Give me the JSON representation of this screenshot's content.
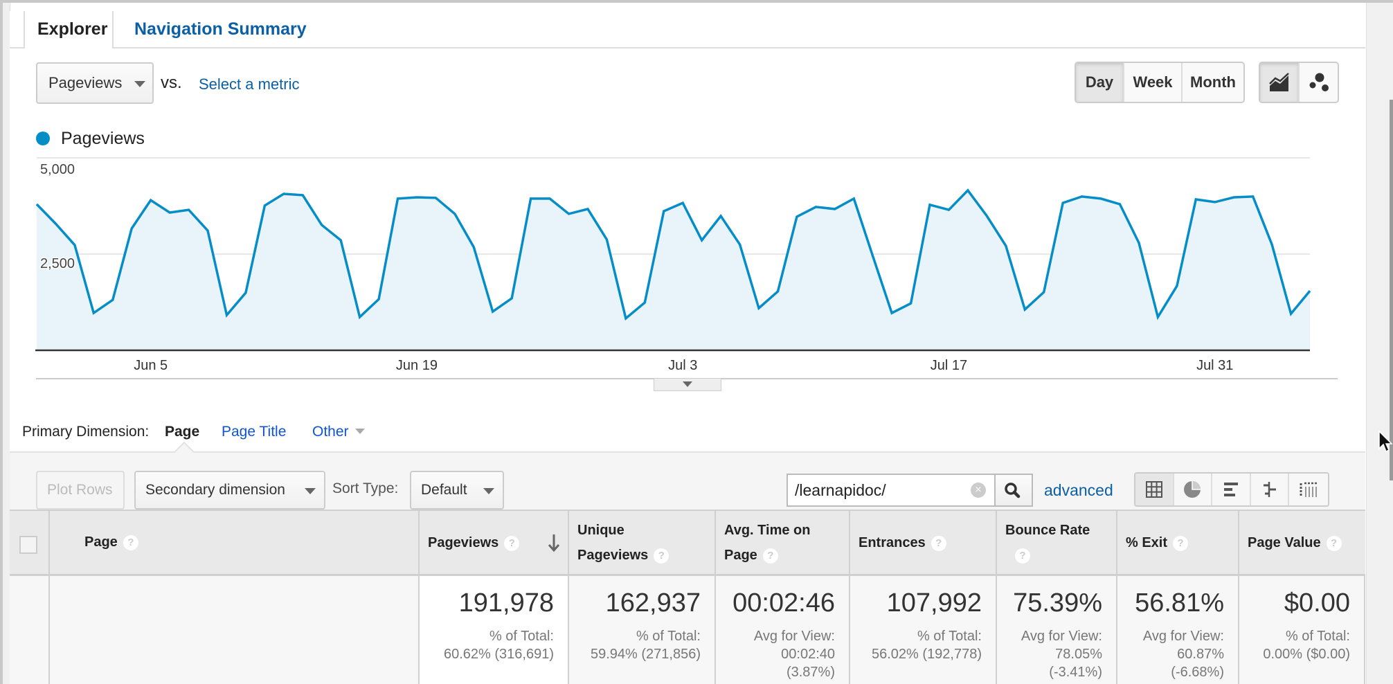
{
  "tabs": [
    {
      "label": "Explorer",
      "active": true
    },
    {
      "label": "Navigation Summary",
      "active": false
    }
  ],
  "metric_selector": {
    "selected": "Pageviews",
    "vs_label": "vs.",
    "compare_link": "Select a metric"
  },
  "time_granularity": {
    "options": [
      "Day",
      "Week",
      "Month"
    ],
    "selected": "Day"
  },
  "chart_type_buttons": [
    {
      "icon": "line-chart-icon",
      "active": true
    },
    {
      "icon": "motion-chart-icon",
      "active": false
    }
  ],
  "chart_data": {
    "type": "area",
    "title": "",
    "legend": [
      {
        "name": "Pageviews",
        "color": "#058dc7"
      }
    ],
    "legend_placement": "top-left",
    "xlabel": "",
    "ylabel": "",
    "ylim": [
      0,
      5000
    ],
    "y_ticks": [
      "5,000",
      "2,500"
    ],
    "y_tick_values": [
      5000,
      2500
    ],
    "x_tick_labels": [
      "Jun 5",
      "Jun 19",
      "Jul 3",
      "Jul 17",
      "Jul 31"
    ],
    "x_tick_indices": [
      6,
      20,
      34,
      48,
      62
    ],
    "x_start": "May 30",
    "x_end": "Aug 5",
    "grid": true,
    "series": [
      {
        "name": "Pageviews",
        "color": "#058dc7",
        "fill": "#e8f3fa",
        "values": [
          3795,
          3290,
          2735,
          970,
          1310,
          3165,
          3900,
          3580,
          3650,
          3110,
          915,
          1495,
          3760,
          4065,
          4030,
          3255,
          2860,
          865,
          1330,
          3940,
          3975,
          3960,
          3545,
          2680,
          1005,
          1350,
          3940,
          3940,
          3545,
          3670,
          2880,
          830,
          1240,
          3615,
          3830,
          2860,
          3490,
          2750,
          1095,
          1530,
          3470,
          3725,
          3670,
          3940,
          2445,
          970,
          1220,
          3780,
          3650,
          4155,
          3490,
          2715,
          1060,
          1510,
          3830,
          3995,
          3940,
          3795,
          2790,
          865,
          1670,
          3920,
          3850,
          3975,
          3995,
          2750,
          950,
          1545
        ]
      }
    ]
  },
  "primary_dimension": {
    "label": "Primary Dimension:",
    "options": [
      "Page",
      "Page Title",
      "Other"
    ],
    "selected": "Page"
  },
  "toolbar": {
    "plot_rows": "Plot Rows",
    "secondary_dimension": "Secondary dimension",
    "sort_type_label": "Sort Type:",
    "sort_type_value": "Default",
    "search_value": "/learnapidoc/",
    "advanced_link": "advanced",
    "view_buttons": [
      "data-table-icon",
      "pie-chart-icon",
      "bar-performance-icon",
      "comparison-icon",
      "pivot-icon"
    ]
  },
  "table": {
    "columns": [
      {
        "label": "Page",
        "help": "?"
      },
      {
        "label": "Pageviews",
        "help": "?",
        "sorted": "desc"
      },
      {
        "label": "Unique Pageviews",
        "help": "?"
      },
      {
        "label": "Avg. Time on Page",
        "help": "?"
      },
      {
        "label": "Entrances",
        "help": "?"
      },
      {
        "label": "Bounce Rate",
        "help": "?"
      },
      {
        "label": "% Exit",
        "help": "?"
      },
      {
        "label": "Page Value",
        "help": "?"
      }
    ],
    "header_lines": {
      "page": "Page",
      "pageviews": "Pageviews",
      "unique_1": "Unique",
      "unique_2": "Pageviews",
      "avgtime_1": "Avg. Time on",
      "avgtime_2": "Page",
      "entrances": "Entrances",
      "bounce": "Bounce Rate",
      "exit": "% Exit",
      "value": "Page Value"
    },
    "totals": [
      {
        "value": "191,978",
        "sub": "% of Total:\n60.62% (316,691)"
      },
      {
        "value": "162,937",
        "sub": "% of Total:\n59.94% (271,856)"
      },
      {
        "value": "00:02:46",
        "sub": "Avg for View:\n00:02:40\n(3.87%)"
      },
      {
        "value": "107,992",
        "sub": "% of Total:\n56.02% (192,778)"
      },
      {
        "value": "75.39%",
        "sub": "Avg for View:\n78.05%\n(-3.41%)"
      },
      {
        "value": "56.81%",
        "sub": "Avg for View:\n60.87%\n(-6.68%)"
      },
      {
        "value": "$0.00",
        "sub": "% of Total:\n0.00% ($0.00)"
      }
    ]
  },
  "help_glyph": "?",
  "clear_glyph": "×"
}
